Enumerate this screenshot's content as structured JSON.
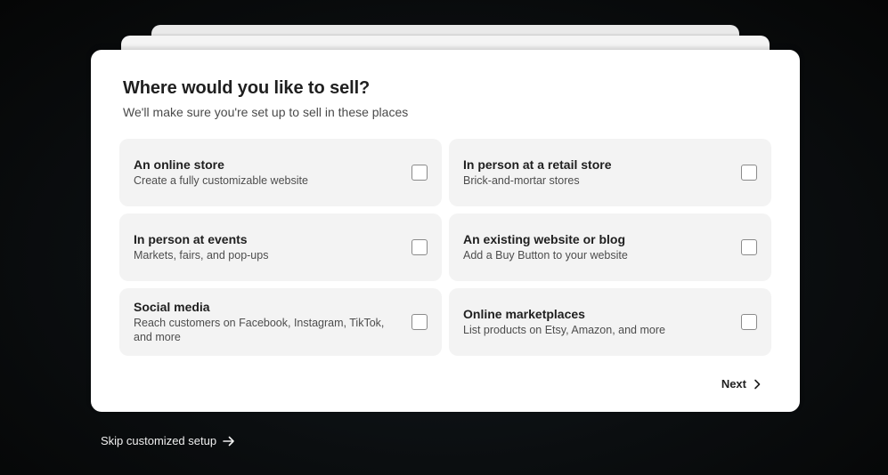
{
  "dialog": {
    "title": "Where would you like to sell?",
    "subtitle": "We'll make sure you're set up to sell in these places"
  },
  "options": [
    {
      "title": "An online store",
      "description": "Create a fully customizable website",
      "checked": false
    },
    {
      "title": "In person at a retail store",
      "description": "Brick-and-mortar stores",
      "checked": false
    },
    {
      "title": "In person at events",
      "description": "Markets, fairs, and pop-ups",
      "checked": false
    },
    {
      "title": "An existing website or blog",
      "description": "Add a Buy Button to your website",
      "checked": false
    },
    {
      "title": "Social media",
      "description": "Reach customers on Facebook, Instagram, TikTok, and more",
      "checked": false
    },
    {
      "title": "Online marketplaces",
      "description": "List products on Etsy, Amazon, and more",
      "checked": false
    }
  ],
  "footer": {
    "next_label": "Next",
    "next_icon": "chevron-right-icon"
  },
  "skip": {
    "label": "Skip customized setup",
    "icon": "arrow-right-icon"
  },
  "colors": {
    "background": "#0b0e10",
    "card": "#ffffff",
    "option_background": "#f3f3f3",
    "text_primary": "#1f1f1f",
    "text_secondary": "#4d4d4d"
  }
}
